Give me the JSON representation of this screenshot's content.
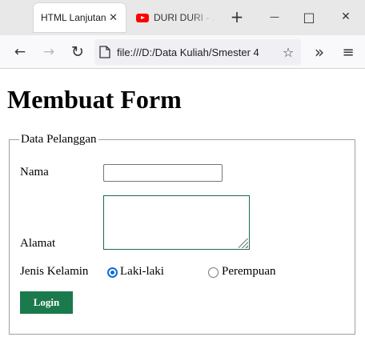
{
  "browser": {
    "tabs": [
      {
        "title": "HTML Lanjutan",
        "active": true
      },
      {
        "title": "DURI DURI - Z",
        "active": false
      }
    ],
    "new_tab_symbol": "+",
    "minimize_symbol": "—",
    "maximize_symbol": "□",
    "close_symbol": "✕",
    "tab_close_symbol": "✕",
    "back_symbol": "←",
    "forward_symbol": "→",
    "reload_symbol": "↻",
    "url": "file:///D:/Data Kuliah/Smester 4",
    "bookmark_symbol": "☆",
    "overflow_symbol": "»",
    "menu_symbol": "≡",
    "accent_youtube": "#ff0000"
  },
  "page": {
    "heading": "Membuat Form",
    "fieldset_legend": "Data Pelanggan",
    "labels": {
      "nama": "Nama",
      "alamat": "Alamat",
      "jenis_kelamin": "Jenis Kelamin"
    },
    "nama_value": "",
    "alamat_value": "",
    "gender_options": [
      {
        "label": "Laki-laki",
        "checked": true
      },
      {
        "label": "Perempuan",
        "checked": false
      }
    ],
    "submit_label": "Login",
    "submit_color": "#1a7a4c"
  }
}
